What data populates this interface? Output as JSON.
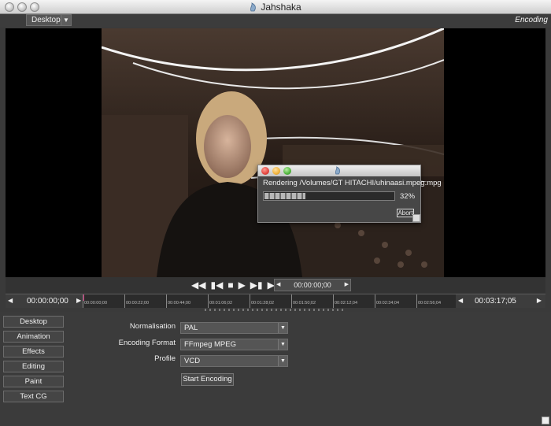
{
  "window": {
    "title": "Jahshaka"
  },
  "topbar": {
    "desktop_select": "Desktop",
    "mode_label": "Encoding"
  },
  "dialog": {
    "path": "Rendering /Volumes/GT HITACHI/uhinaasi.mpeg.mpg",
    "progress_text": "32%",
    "progress": 0.32,
    "abort_label": "Abort"
  },
  "transport": {
    "timecode": "00:00:00;00"
  },
  "timeline": {
    "start_tc": "00:00:00;00",
    "end_tc": "00:03:17;05",
    "ticks": [
      "00:00:00;00",
      "00:00:22;00",
      "00:00:44;00",
      "00:01:06;02",
      "00:01:28;02",
      "00:01:50;02",
      "00:02:12;04",
      "00:02:34;04",
      "00:02:56;04"
    ]
  },
  "sidebar": {
    "items": [
      {
        "label": "Desktop"
      },
      {
        "label": "Animation"
      },
      {
        "label": "Effects"
      },
      {
        "label": "Editing"
      },
      {
        "label": "Paint"
      },
      {
        "label": "Text CG"
      }
    ]
  },
  "form": {
    "normalisation_label": "Normalisation",
    "normalisation_value": "PAL",
    "format_label": "Encoding Format",
    "format_value": "FFmpeg MPEG",
    "profile_label": "Profile",
    "profile_value": "VCD",
    "start_label": "Start Encoding"
  },
  "colors": {
    "close_light": "#e2463f",
    "min_light": "#f0b23a",
    "max_light": "#4fb43c",
    "playhead": "#d0307a"
  }
}
